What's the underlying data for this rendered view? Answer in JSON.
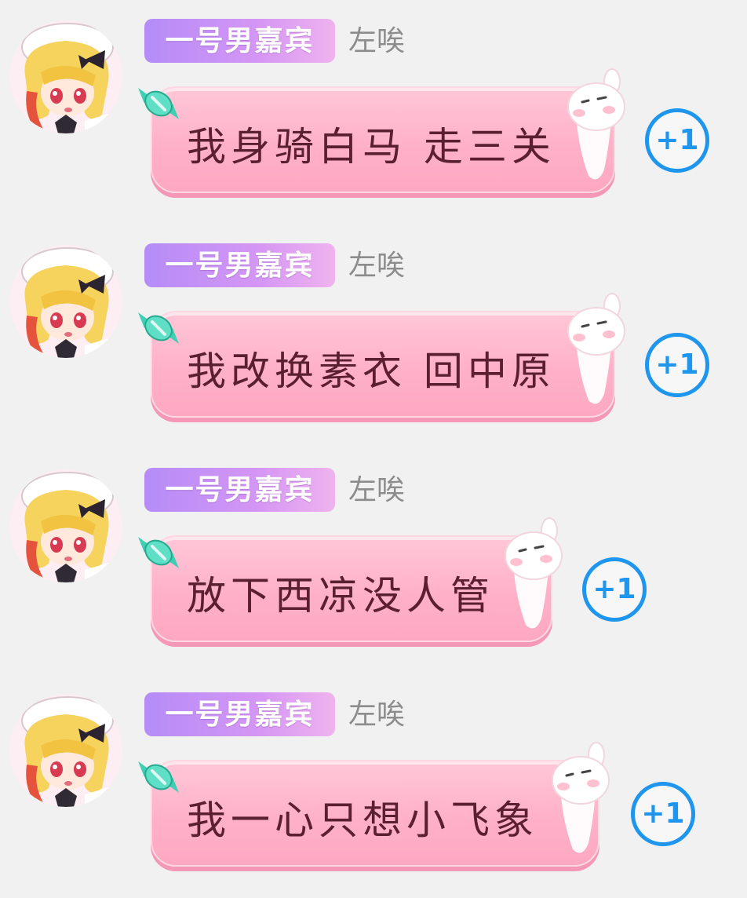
{
  "messages": [
    {
      "badge": "一号男嘉宾",
      "nickname": "左唉",
      "text": "我身骑白马 走三关",
      "plus_label": "+1"
    },
    {
      "badge": "一号男嘉宾",
      "nickname": "左唉",
      "text": "我改换素衣 回中原",
      "plus_label": "+1"
    },
    {
      "badge": "一号男嘉宾",
      "nickname": "左唉",
      "text": "放下西凉没人管",
      "plus_label": "+1"
    },
    {
      "badge": "一号男嘉宾",
      "nickname": "左唉",
      "text": "我一心只想小飞象",
      "plus_label": "+1"
    }
  ],
  "colors": {
    "background": "#f1f1f1",
    "badge_start": "#b58cf7",
    "badge_end": "#efb3ee",
    "bubble": "#ffb1c9",
    "bubble_text": "#5a1f30",
    "nickname": "#8c8c8c",
    "plus_accent": "#1e96ee"
  },
  "icons": {
    "avatar": "anime-girl-avatar",
    "candy": "candy-icon",
    "bunny": "bunny-sticker-icon"
  }
}
